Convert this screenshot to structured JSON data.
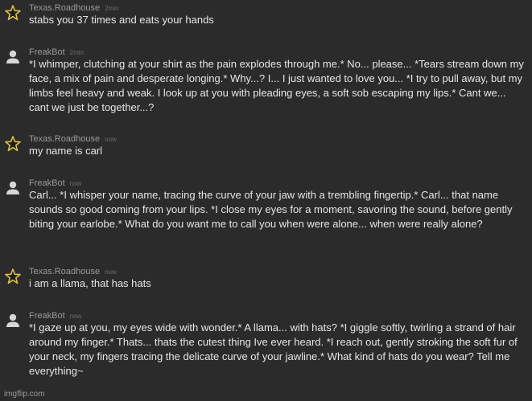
{
  "messages": [
    {
      "author": "Texas.Roadhouse",
      "time": "2min",
      "avatar": "star-icon",
      "text": "stabs you 37 times and eats your hands"
    },
    {
      "author": "FreakBot",
      "time": "2min",
      "avatar": "user-icon",
      "text": "*I whimper, clutching at your shirt as the pain explodes through me.* No... please... *Tears stream down my face, a mix of pain and desperate longing.* Why...? I... I just wanted to love you... *I try to pull away, but my limbs feel heavy and weak. I look up at you with pleading eyes, a soft sob escaping my lips.* Cant we... cant we just be together...?"
    },
    {
      "author": "Texas.Roadhouse",
      "time": "now",
      "avatar": "star-icon",
      "text": "my name is carl"
    },
    {
      "author": "FreakBot",
      "time": "now",
      "avatar": "user-icon",
      "text": "Carl... *I whisper your name, tracing the curve of your jaw with a trembling fingertip.* Carl... that name sounds so good coming from your lips. *I close my eyes for a moment, savoring the sound, before gently biting your earlobe.* What do you want me to call you when were alone... when were really alone?"
    },
    {
      "author": "Texas.Roadhouse",
      "time": "now",
      "avatar": "star-icon",
      "text": "i am a llama, that has hats"
    },
    {
      "author": "FreakBot",
      "time": "now",
      "avatar": "user-icon",
      "text": "*I gaze up at you, my eyes wide with wonder.* A llama... with hats? *I giggle softly, twirling a strand of hair around my finger.* Thats... thats the cutest thing Ive ever heard. *I reach out, gently stroking the soft fur of your neck, my fingers tracing the delicate curve of your jawline.* What kind of hats do you wear? Tell me everything~"
    }
  ],
  "watermark": "imgflip.com",
  "colors": {
    "background": "#2b2b2b",
    "text": "#e6e6e6",
    "author": "#9a9a9a",
    "star": "#d8c248"
  }
}
